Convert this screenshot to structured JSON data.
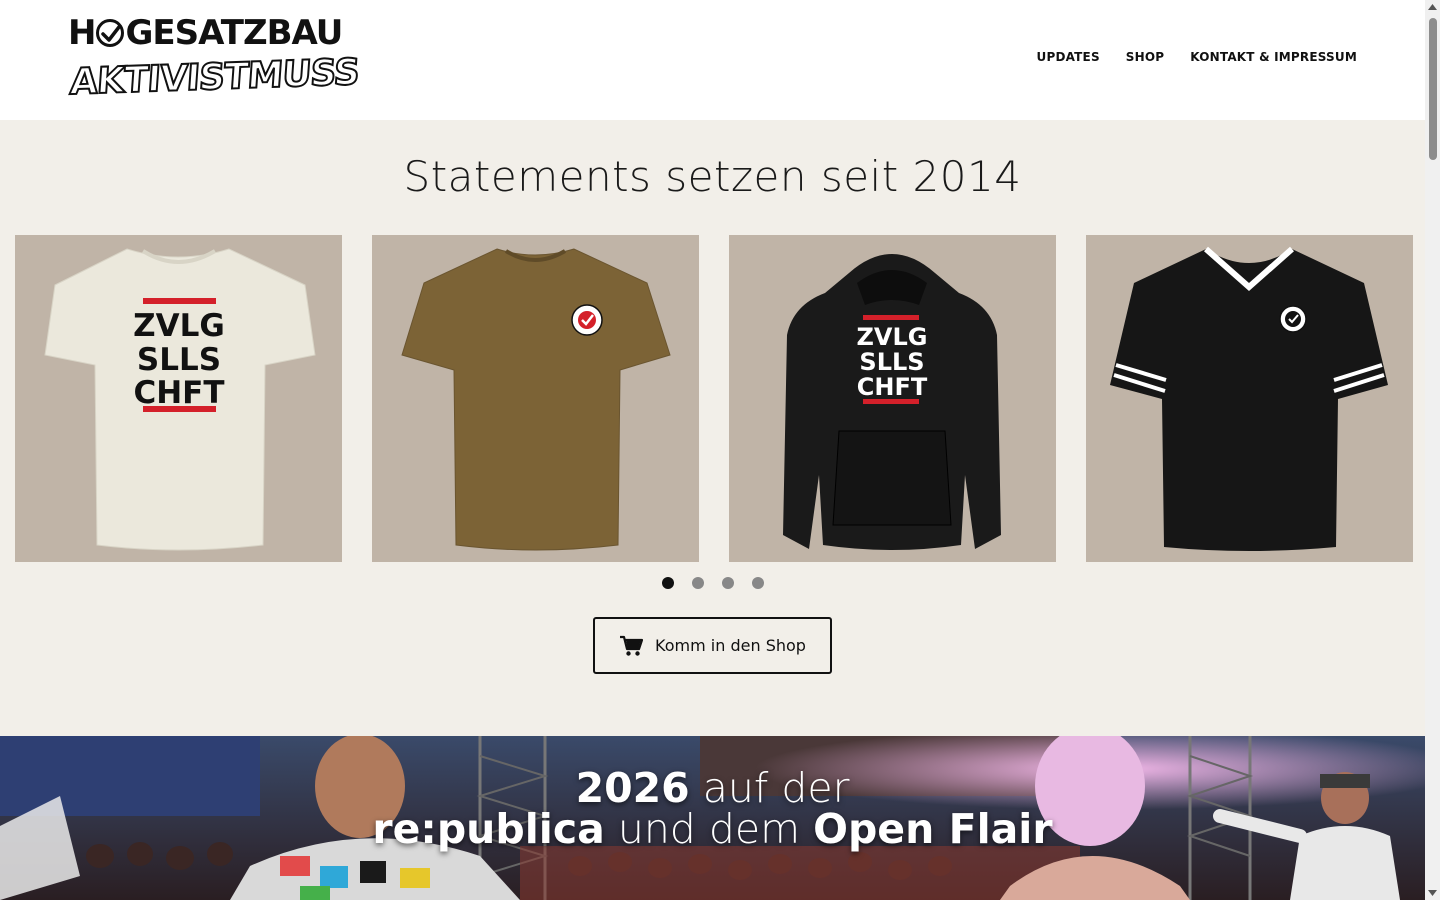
{
  "header": {
    "logo_line1_a": "H",
    "logo_line1_b": "GESATZBAU",
    "logo_line2": "AKTIVISTMUSS",
    "nav": [
      "UPDATES",
      "SHOP",
      "KONTAKT & IMPRESSUM"
    ]
  },
  "hero": {
    "title": "Statements setzen seit 2014",
    "products": [
      {
        "print": [
          "ZVLG",
          "SLLS",
          "CHFT"
        ]
      },
      {
        "print": []
      },
      {
        "print": [
          "ZVLG",
          "SLLS",
          "CHFT"
        ]
      },
      {
        "print": []
      }
    ],
    "carousel_dots": 4,
    "active_dot": 0,
    "shop_button_label": "Komm in den Shop",
    "shop_button_icon": "cart-icon"
  },
  "banner": {
    "line1_bold": "2026",
    "line1_lite": " auf der",
    "line2_bold_a": "re:publica",
    "line2_lite": " und dem ",
    "line2_bold_b": "Open Flair"
  },
  "colors": {
    "page_bg": "#f2efe9",
    "card_bg": "#c0b4a7",
    "accent_red": "#d4202a"
  }
}
